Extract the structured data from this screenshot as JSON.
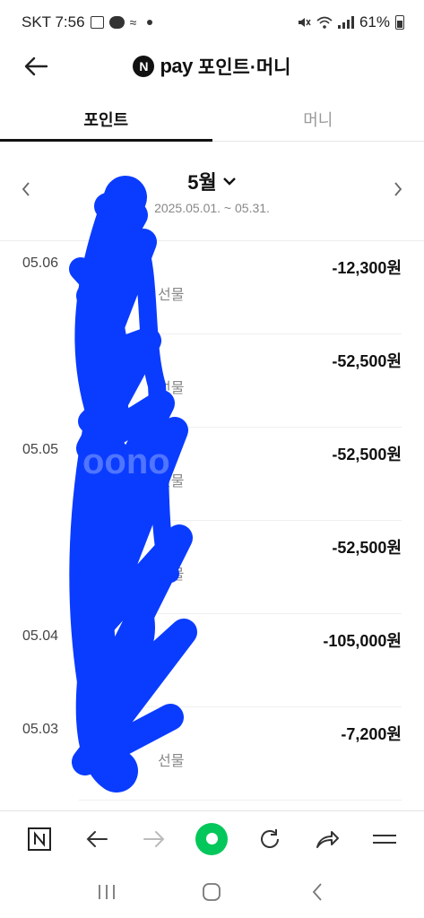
{
  "status_bar": {
    "carrier_time": "SKT 7:56",
    "battery": "61%"
  },
  "header": {
    "logo_letter": "N",
    "pay_word": "pay",
    "title": "포인트·머니"
  },
  "tabs": [
    {
      "label": "포인트",
      "active": true
    },
    {
      "label": "머니",
      "active": false
    }
  ],
  "month": {
    "label": "5월",
    "range": "2025.05.01. ~ 05.31."
  },
  "transactions": [
    {
      "date": "05.06",
      "amount": "-12,300원",
      "desc": "선물"
    },
    {
      "date": "",
      "amount": "-52,500원",
      "desc": "선물"
    },
    {
      "date": "05.05",
      "amount": "-52,500원",
      "desc": "선물"
    },
    {
      "date": "",
      "amount": "-52,500원",
      "desc": "선물"
    },
    {
      "date": "05.04",
      "amount": "-105,000원",
      "desc": ""
    },
    {
      "date": "05.03",
      "amount": "-7,200원",
      "desc": "선물"
    }
  ],
  "colors": {
    "accent_green": "#03c75a",
    "redaction_blue": "#0a3cff"
  },
  "icons": {
    "back": "arrow-left-icon",
    "prev_month": "chevron-left-icon",
    "next_month": "chevron-right-icon",
    "month_dropdown": "chevron-down-icon",
    "browser": [
      "naver-home-icon",
      "arrow-left-icon",
      "arrow-right-icon",
      "green-circle-icon",
      "refresh-icon",
      "share-icon",
      "menu-icon"
    ],
    "nav": [
      "recent-apps-icon",
      "home-icon",
      "back-icon"
    ]
  }
}
